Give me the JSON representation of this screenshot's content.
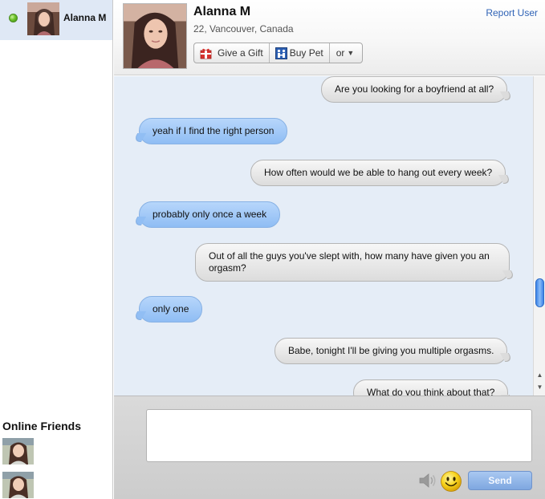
{
  "sidebar": {
    "active_contact_name": "Alanna M",
    "online_friends_title": "Online Friends"
  },
  "profile": {
    "name": "Alanna M",
    "meta": "22, Vancouver, Canada",
    "report_label": "Report User",
    "actions": {
      "gift_label": "Give a Gift",
      "pet_label": "Buy Pet",
      "or_label": "or"
    }
  },
  "messages": [
    {
      "sender": "me",
      "text": "Are you looking for a boyfriend at all?"
    },
    {
      "sender": "them",
      "text": "yeah if I find the right person"
    },
    {
      "sender": "me",
      "text": "How often would we be able to hang out every week?"
    },
    {
      "sender": "them",
      "text": "probably only once a week"
    },
    {
      "sender": "me",
      "text": "Out of all the guys you've slept with, how many have given you an orgasm?"
    },
    {
      "sender": "them",
      "text": "only one"
    },
    {
      "sender": "me",
      "text": "Babe, tonight I'll be giving you multiple orgasms."
    },
    {
      "sender": "me",
      "text": "What do you think about that?"
    }
  ],
  "composer": {
    "input_value": "",
    "send_label": "Send"
  },
  "icons": {
    "online_status": "green-dot-icon",
    "gift": "gift-icon",
    "pet": "pet-icon",
    "dropdown": "chevron-down-icon",
    "sound": "speaker-icon",
    "emoji": "smiley-icon"
  },
  "colors": {
    "chat_background": "#e5edf7",
    "received_bubble": "#9cc6f6",
    "sent_bubble": "#e6e6e6",
    "link": "#2f63b6",
    "send_button": "#8fb3e8"
  }
}
